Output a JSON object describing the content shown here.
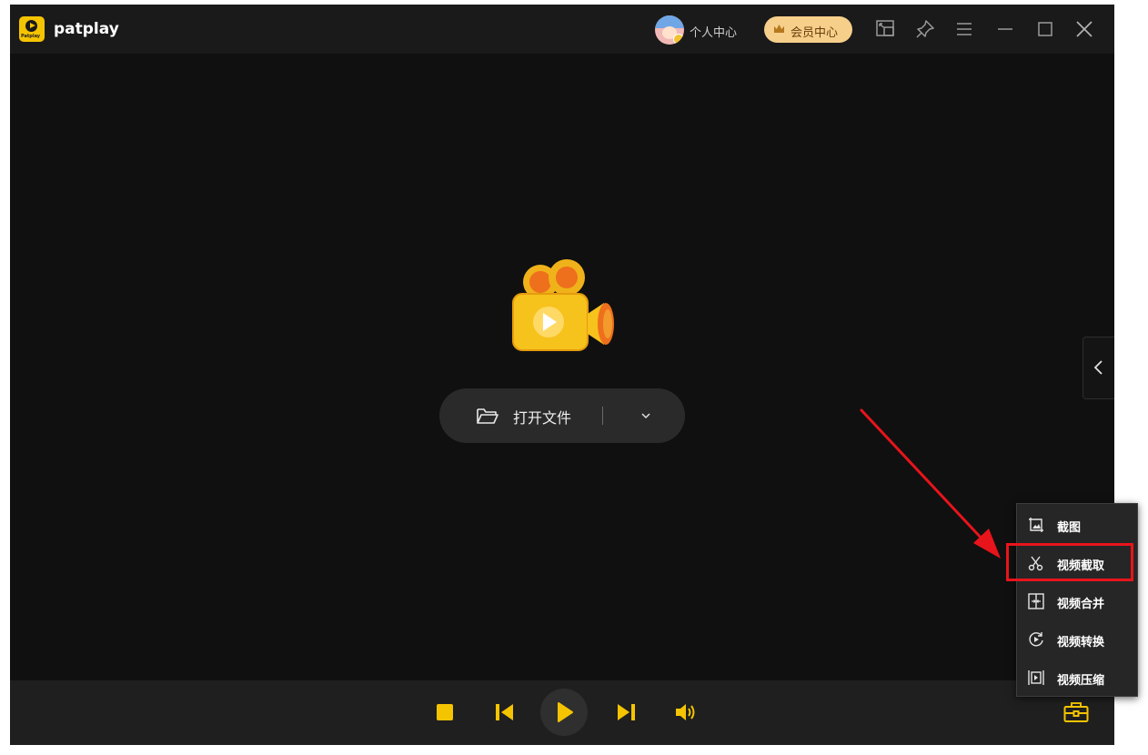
{
  "app": {
    "title": "patplay",
    "logo_text": "Patplay"
  },
  "header": {
    "profile_label": "个人中心",
    "vip_label": "会员中心",
    "icons": [
      "picture-in-picture-icon",
      "pin-icon",
      "menu-icon",
      "minimize-icon",
      "maximize-icon",
      "close-icon"
    ]
  },
  "main": {
    "open_file_label": "打开文件"
  },
  "tools_menu": {
    "items": [
      {
        "label": "截图",
        "icon": "screenshot-icon"
      },
      {
        "label": "视频截取",
        "icon": "scissors-icon",
        "highlighted": true
      },
      {
        "label": "视频合并",
        "icon": "merge-icon"
      },
      {
        "label": "视频转换",
        "icon": "convert-icon"
      },
      {
        "label": "视频压缩",
        "icon": "compress-icon"
      }
    ]
  },
  "controls": [
    "stop-icon",
    "previous-icon",
    "play-icon",
    "next-icon",
    "volume-icon",
    "toolbox-icon"
  ],
  "colors": {
    "accent": "#f5c400",
    "annotation": "#e8141b",
    "background": "#101010"
  }
}
